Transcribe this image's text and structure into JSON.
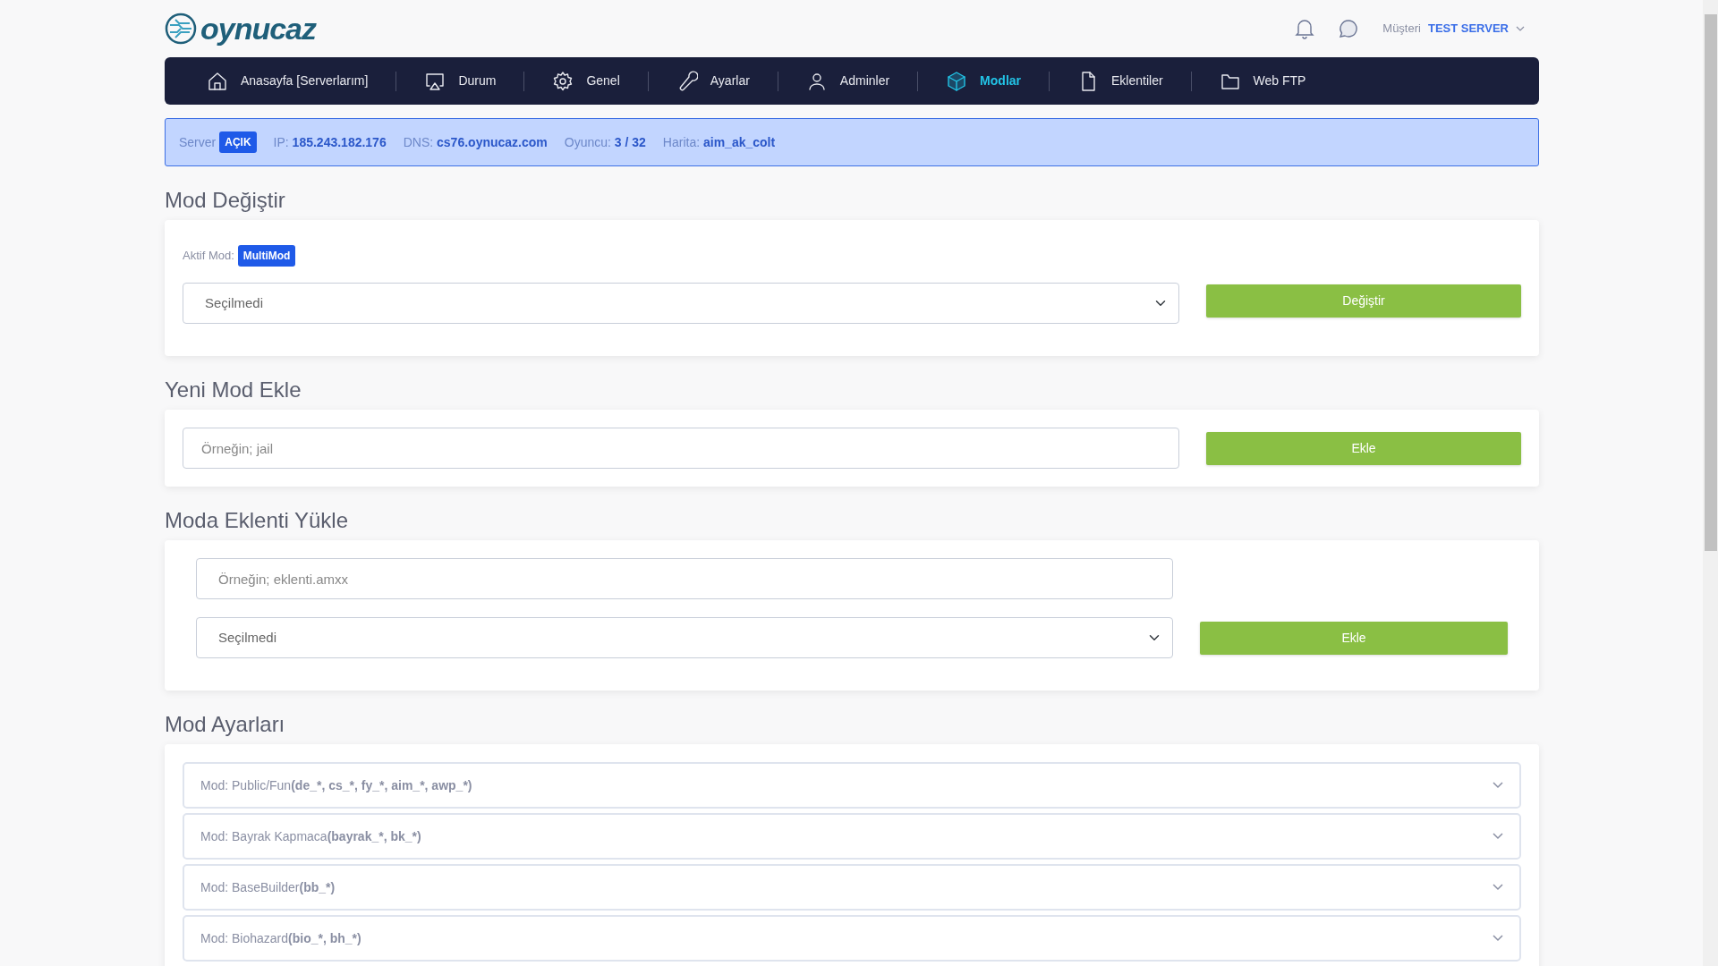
{
  "logo": {
    "text": "oynucaz"
  },
  "header": {
    "user_label": "Müşteri",
    "user_name": "TEST SERVER"
  },
  "nav": [
    {
      "label": "Anasayfa [Serverlarım]",
      "selected": false
    },
    {
      "label": "Durum",
      "selected": false
    },
    {
      "label": "Genel",
      "selected": false
    },
    {
      "label": "Ayarlar",
      "selected": false
    },
    {
      "label": "Adminler",
      "selected": false
    },
    {
      "label": "Modlar",
      "selected": true
    },
    {
      "label": "Eklentiler",
      "selected": false
    },
    {
      "label": "Web FTP",
      "selected": false
    }
  ],
  "server_info": {
    "server_label": "Server",
    "status": "AÇIK",
    "online": true,
    "items": [
      {
        "label": "IP:",
        "value": "185.243.182.176"
      },
      {
        "label": "DNS:",
        "value": "cs76.oynucaz.com"
      },
      {
        "label": "Oyuncu:",
        "value": "3 / 32"
      },
      {
        "label": "Harita:",
        "value": "aim_ak_colt"
      }
    ]
  },
  "mod_change": {
    "title": "Mod Değiştir",
    "active_label": "Aktif Mod:",
    "active_mod": "MultiMod",
    "select_value": "Seçilmedi",
    "button": "Değiştir"
  },
  "new_mod": {
    "title": "Yeni Mod Ekle",
    "placeholder": "Örneğin; jail",
    "button": "Ekle"
  },
  "plugin_upload": {
    "title": "Moda Eklenti Yükle",
    "placeholder": "Örneğin; eklenti.amxx",
    "select_value": "Seçilmedi",
    "button": "Ekle"
  },
  "mod_settings": {
    "title": "Mod Ayarları",
    "items": [
      {
        "name": "Mod: Public/Fun",
        "pattern": "(de_*, cs_*, fy_*, aim_*, awp_*)",
        "expanded": false
      },
      {
        "name": "Mod: Bayrak Kapmaca",
        "pattern": "(bayrak_*, bk_*)",
        "expanded": false
      },
      {
        "name": "Mod: BaseBuilder",
        "pattern": "(bb_*)",
        "expanded": false
      },
      {
        "name": "Mod: Biohazard",
        "pattern": "(bio_*, bh_*)",
        "expanded": false
      }
    ]
  }
}
